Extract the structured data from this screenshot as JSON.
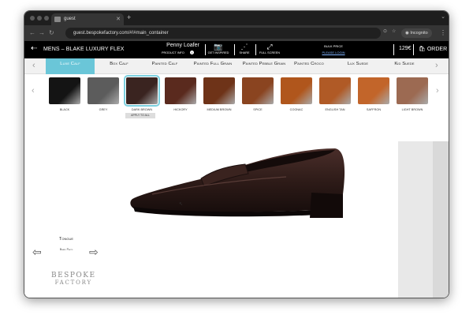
{
  "browser": {
    "tab_title": "guest",
    "url": "guest.bespokefactory.com/#!#main_container",
    "incognito_label": "Incognito"
  },
  "header": {
    "title": "MENS – BLAKE LUXURY FLEX",
    "product_name": "Penny Loafer",
    "product_info": "PRODUCT INFO",
    "get_inspired": "GET INSPIRED",
    "share": "SHARE",
    "full_screen": "FULL SCREEN",
    "bulk_price": "BULK PRICE",
    "please_login": "PLEASE LOGIN",
    "price": "129€",
    "order": "ORDER"
  },
  "materials": {
    "items": [
      {
        "label": "Luxe Calf",
        "active": true
      },
      {
        "label": "Box Calf"
      },
      {
        "label": "Painted Calf"
      },
      {
        "label": "Painted Full Grain"
      },
      {
        "label": "Painted Pebble Grain"
      },
      {
        "label": "Painted Croco"
      },
      {
        "label": "Lux Suede"
      },
      {
        "label": "Kid Suede"
      }
    ]
  },
  "colors": {
    "items": [
      {
        "label": "Black",
        "color": "#141414"
      },
      {
        "label": "Grey",
        "color": "#5c5c5c"
      },
      {
        "label": "Dark Brown",
        "color": "#3a2420",
        "selected": true
      },
      {
        "label": "Hickory",
        "color": "#5a2a1e"
      },
      {
        "label": "Medium Brown",
        "color": "#6e3318"
      },
      {
        "label": "Spice",
        "color": "#8a4420"
      },
      {
        "label": "Cognac",
        "color": "#b0561c"
      },
      {
        "label": "English Tan",
        "color": "#b05a26"
      },
      {
        "label": "Saffron",
        "color": "#c2652a"
      },
      {
        "label": "Light Brown",
        "color": "#9c6a52"
      }
    ],
    "apply_all": "APPLY TO ALL"
  },
  "part": {
    "name": "Tongue",
    "sub": "Brand Parts"
  },
  "logo": {
    "line1": "BESPOKE",
    "line2": "FACTORY"
  },
  "accent": "#6ac6d8"
}
